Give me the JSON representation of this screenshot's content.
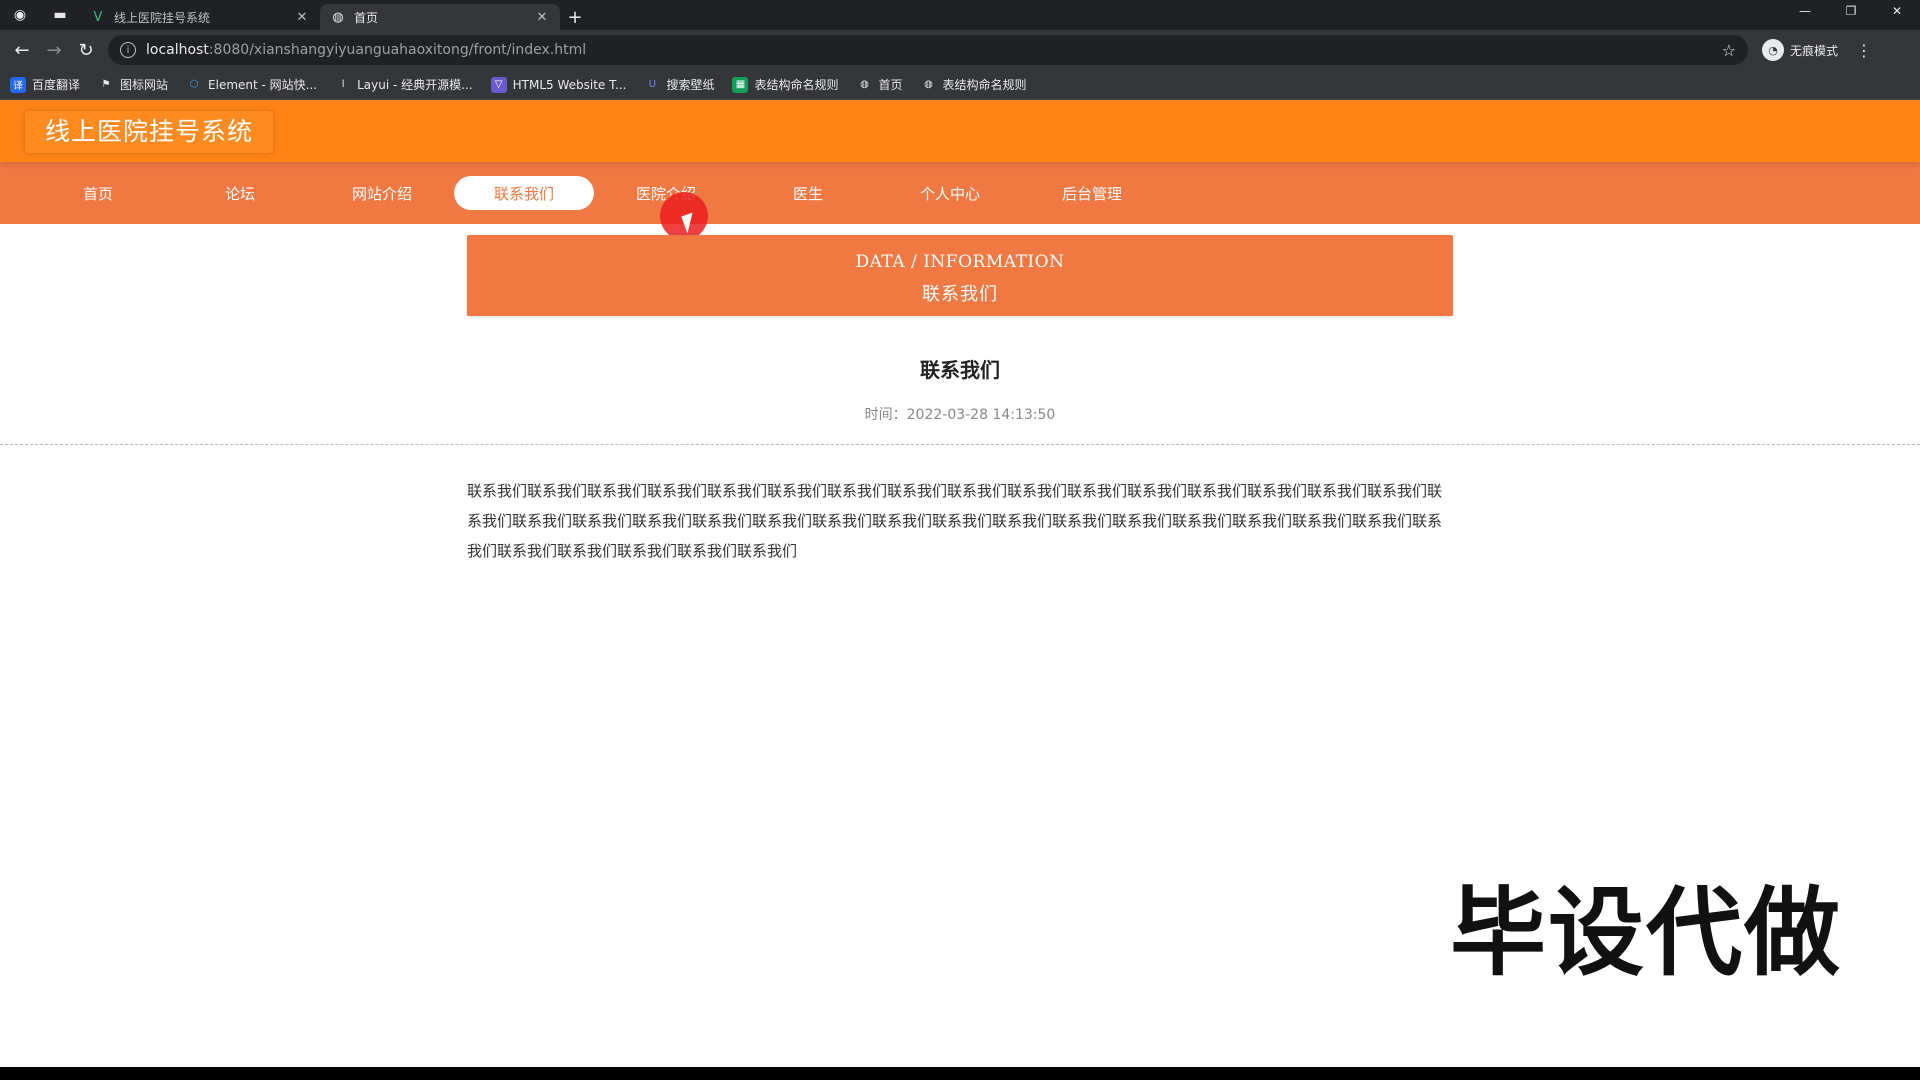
{
  "browser": {
    "tabs": [
      {
        "title": "线上医院挂号系统",
        "favicon": "vue-icon",
        "active": false
      },
      {
        "title": "首页",
        "favicon": "globe-icon",
        "active": true
      }
    ],
    "new_tab_label": "+",
    "url_host": "localhost",
    "url_path": ":8080/xianshangyiyuanguahaoxitong/front/index.html",
    "profile_label": "无痕模式",
    "bookmarks": [
      {
        "label": "百度翻译",
        "icon": "translate-icon",
        "color": "#2468f2"
      },
      {
        "label": "图标网站",
        "icon": "flag-icon",
        "color": "#5f6368"
      },
      {
        "label": "Element - 网站快...",
        "icon": "element-icon",
        "color": "#409eff"
      },
      {
        "label": "Layui - 经典开源模...",
        "icon": "layui-icon",
        "color": "#5f6368"
      },
      {
        "label": "HTML5 Website T...",
        "icon": "html5-icon",
        "color": "#6a5acd"
      },
      {
        "label": "搜索壁纸",
        "icon": "wallpaper-icon",
        "color": "#3b5bdb"
      },
      {
        "label": "表结构命名规则",
        "icon": "sheet-icon",
        "color": "#0f9d58"
      },
      {
        "label": "首页",
        "icon": "globe-icon",
        "color": "#5f6368"
      },
      {
        "label": "表结构命名规则",
        "icon": "globe-icon",
        "color": "#5f6368"
      }
    ]
  },
  "site": {
    "title": "线上医院挂号系统",
    "accent_color": "#ff8316",
    "nav_color": "#f07843",
    "nav": [
      {
        "label": "首页",
        "active": false
      },
      {
        "label": "论坛",
        "active": false
      },
      {
        "label": "网站介绍",
        "active": false
      },
      {
        "label": "联系我们",
        "active": true
      },
      {
        "label": "医院介绍",
        "active": false
      },
      {
        "label": "医生",
        "active": false
      },
      {
        "label": "个人中心",
        "active": false
      },
      {
        "label": "后台管理",
        "active": false
      }
    ]
  },
  "banner": {
    "en": "DATA / INFORMATION",
    "zh": "联系我们"
  },
  "article": {
    "title": "联系我们",
    "time": "时间：2022-03-28 14:13:50",
    "body": "联系我们联系我们联系我们联系我们联系我们联系我们联系我们联系我们联系我们联系我们联系我们联系我们联系我们联系我们联系我们联系我们联系我们联系我们联系我们联系我们联系我们联系我们联系我们联系我们联系我们联系我们联系我们联系我们联系我们联系我们联系我们联系我们联系我们联系我们联系我们联系我们联系我们联系我们"
  },
  "watermark": "毕设代做"
}
